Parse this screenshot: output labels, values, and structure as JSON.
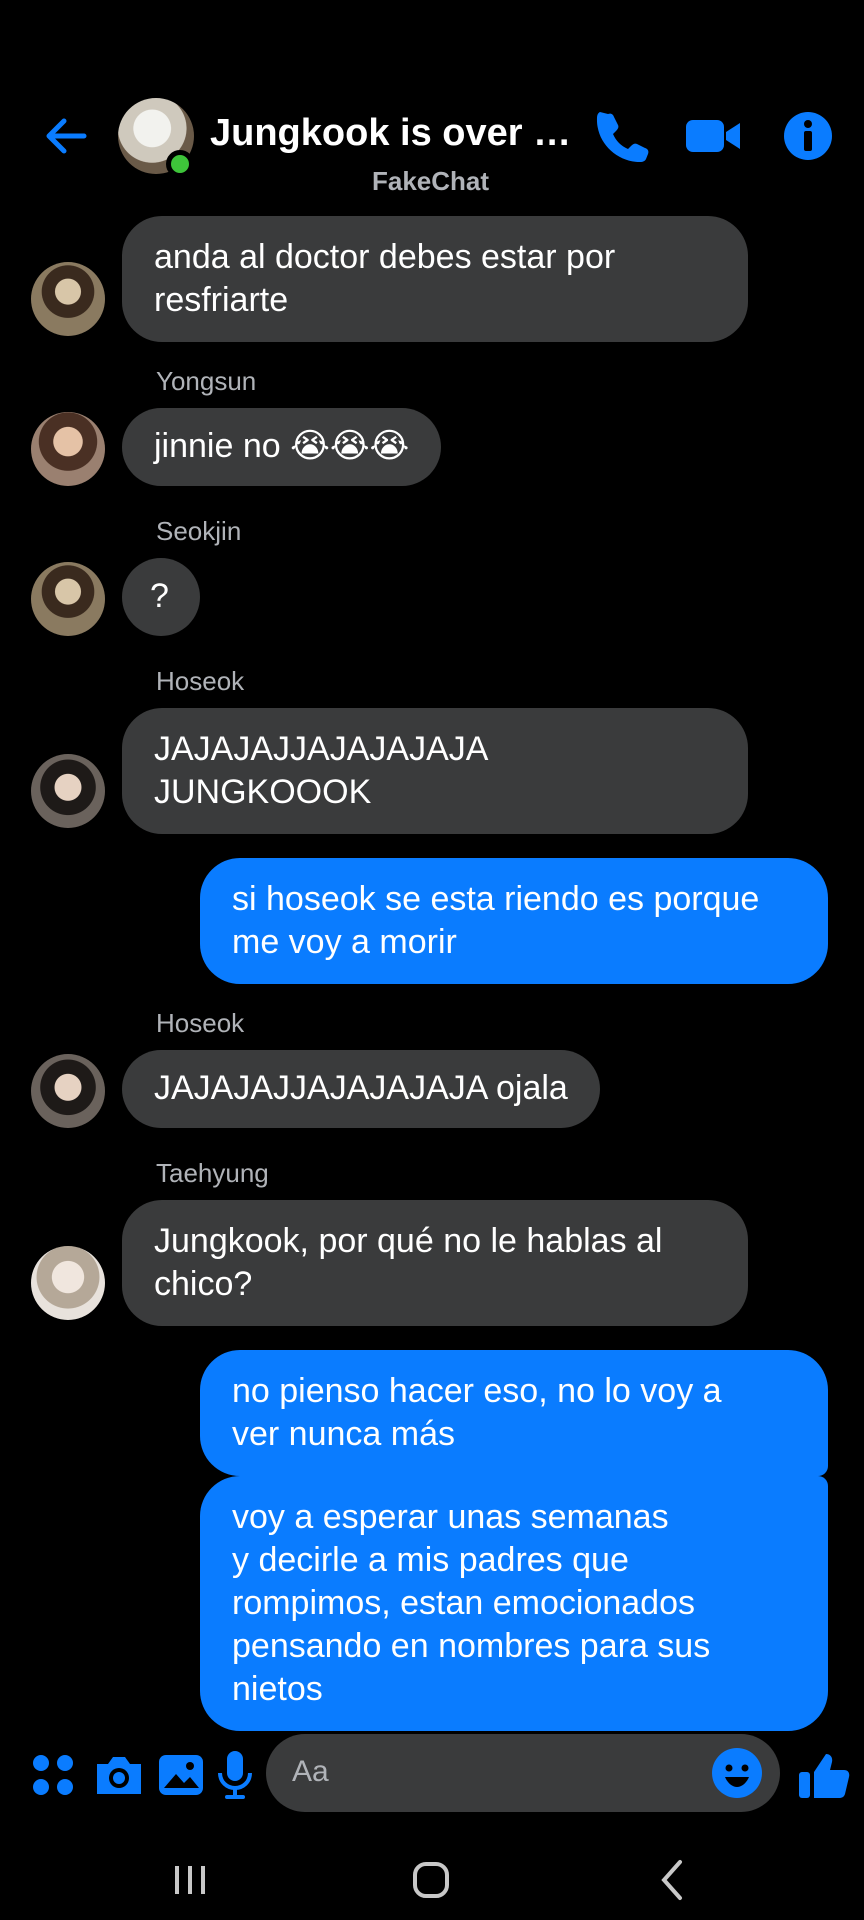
{
  "header": {
    "title": "Jungkook is over p...",
    "subtitle": "FakeChat",
    "back_icon": "arrow-left-icon",
    "call_icon": "phone-icon",
    "video_icon": "video-camera-icon",
    "info_icon": "info-icon",
    "accent": "#0a7cff",
    "online_color": "#3ec43a"
  },
  "messages": [
    {
      "text": "anda al doctor debes estar por\nresfriarte"
    },
    {
      "sender": "Yongsun",
      "text": "jinnie no 😭😭😭"
    },
    {
      "sender": "Seokjin",
      "text": "?"
    },
    {
      "sender": "Hoseok",
      "text": "JAJAJAJJAJAJAJAJA\nJUNGKOOOK"
    },
    {
      "text": "si hoseok se esta riendo es porque\nme voy a morir"
    },
    {
      "sender": "Hoseok",
      "text": "JAJAJAJJAJAJAJAJA ojala"
    },
    {
      "sender": "Taehyung",
      "text": "Jungkook, por qué no le hablas al\nchico?"
    },
    {
      "text": "no pienso hacer eso, no lo voy a\nver nunca más"
    },
    {
      "text": "voy a esperar unas semanas\ny decirle a mis padres que\nrompimos, estan emocionados\npensando en nombres para sus\nnietos"
    }
  ],
  "composer": {
    "placeholder": "Aa",
    "icons": [
      "grid-icon",
      "camera-icon",
      "image-icon",
      "microphone-icon",
      "emoji-icon",
      "thumbs-up-icon"
    ]
  },
  "colors": {
    "incoming_bubble": "#3a3b3c",
    "outgoing_bubble": "#0a7cff",
    "background": "#000000"
  }
}
